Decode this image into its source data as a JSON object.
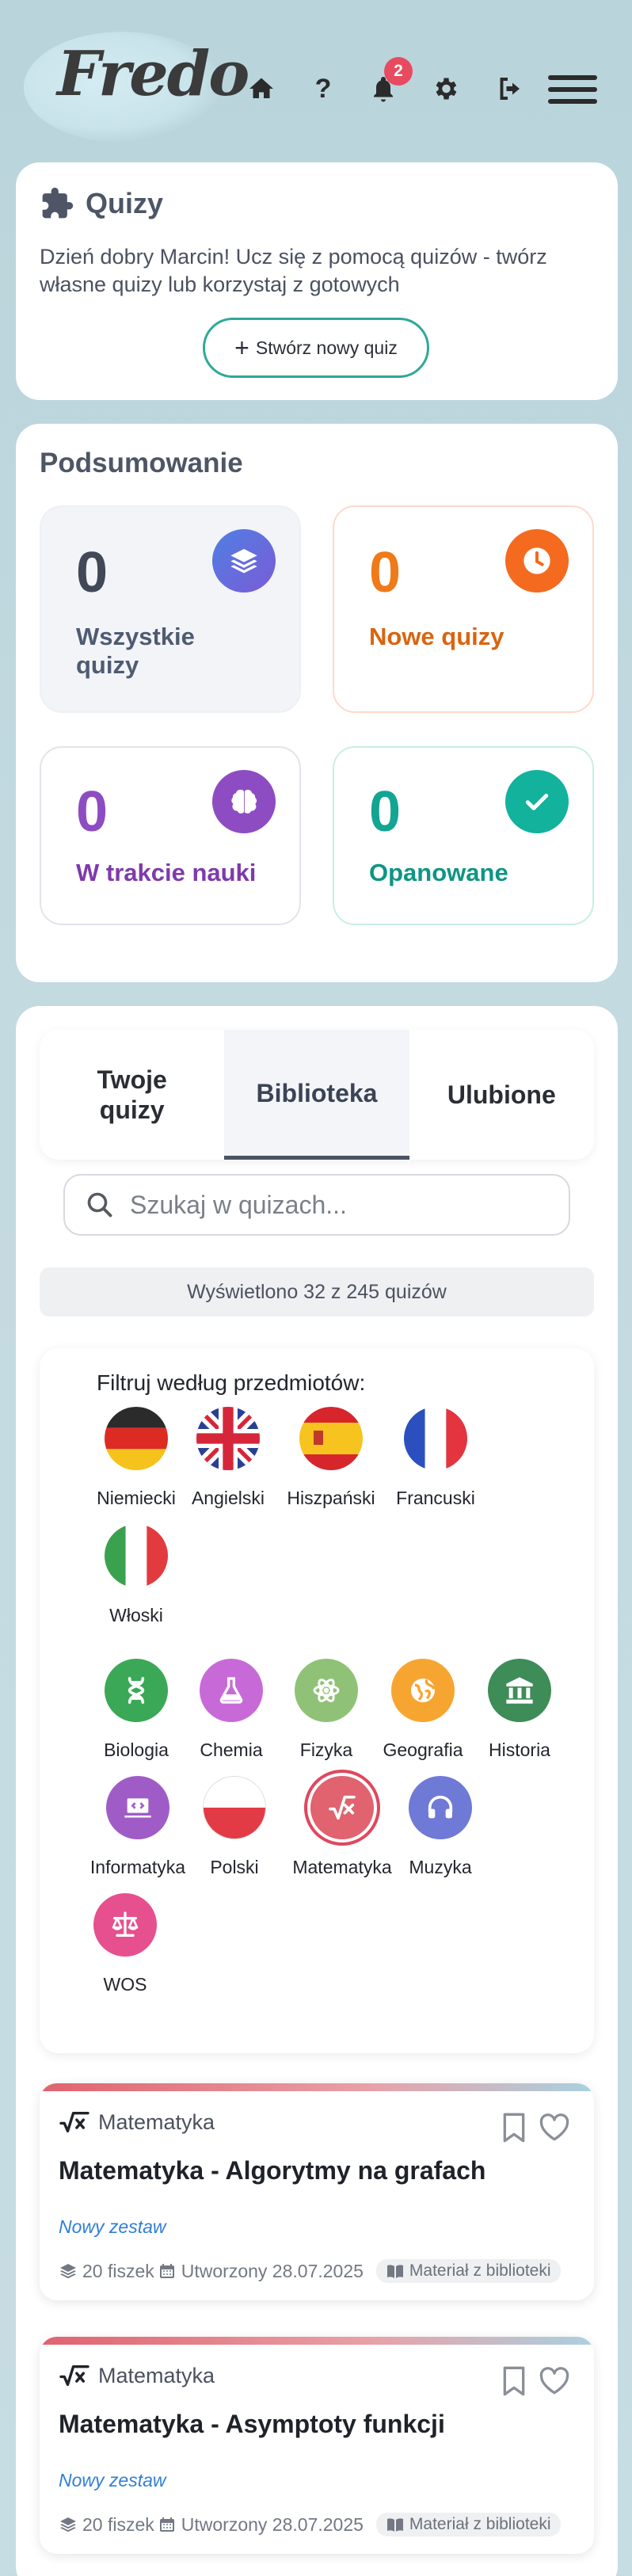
{
  "header": {
    "logo": "Fredo",
    "help_label": "?",
    "notifications_count": "2"
  },
  "quizzes": {
    "title": "Quizy",
    "description": "Dzień dobry Marcin! Ucz się z pomocą quizów - twórz własne quizy lub korzystaj z gotowych",
    "create_button": "Stwórz nowy quiz"
  },
  "summary": {
    "title": "Podsumowanie",
    "stats": [
      {
        "value": "0",
        "label": "Wszystkie quizy",
        "color": "#414857"
      },
      {
        "value": "0",
        "label": "Nowe quizy",
        "color": "#f07a18"
      },
      {
        "value": "0",
        "label": "W trakcie nauki",
        "color": "#8e4cc2"
      },
      {
        "value": "0",
        "label": "Opanowane",
        "color": "#12a593"
      }
    ]
  },
  "tabs": [
    {
      "label": "Twoje quizy",
      "active": false
    },
    {
      "label": "Biblioteka",
      "active": true
    },
    {
      "label": "Ulubione",
      "active": false
    }
  ],
  "search": {
    "placeholder": "Szukaj w quizach...",
    "value": ""
  },
  "results_count": "Wyświetlono 32 z 245 quizów",
  "filter": {
    "title": "Filtruj według przedmiotów:",
    "languages": [
      {
        "label": "Niemiecki",
        "icon": "flag-de"
      },
      {
        "label": "Angielski",
        "icon": "flag-gb"
      },
      {
        "label": "Hiszpański",
        "icon": "flag-es"
      },
      {
        "label": "Francuski",
        "icon": "flag-fr"
      },
      {
        "label": "Włoski",
        "icon": "flag-it"
      }
    ],
    "subjects": [
      {
        "label": "Biologia",
        "icon": "dna-icon",
        "color": "#3aa856"
      },
      {
        "label": "Chemia",
        "icon": "flask-icon",
        "color": "#c76ad8"
      },
      {
        "label": "Fizyka",
        "icon": "atom-icon",
        "color": "#8fc276"
      },
      {
        "label": "Geografia",
        "icon": "globe-icon",
        "color": "#f7a531"
      },
      {
        "label": "Historia",
        "icon": "landmark-icon",
        "color": "#3e8c58"
      },
      {
        "label": "Informatyka",
        "icon": "laptop-code-icon",
        "color": "#a05cc6"
      },
      {
        "label": "Polski",
        "icon": "flag-pl",
        "color": "#e23b46"
      },
      {
        "label": "Matematyka",
        "icon": "square-root-icon",
        "color": "#e0636f",
        "selected": true
      },
      {
        "label": "Muzyka",
        "icon": "headphones-icon",
        "color": "#6f79d6"
      },
      {
        "label": "WOS",
        "icon": "scale-icon",
        "color": "#e6508f"
      }
    ]
  },
  "quiz_cards": [
    {
      "subject": "Matematyka",
      "title": "Matematyka - Algorytmy na grafach",
      "status": "Nowy zestaw",
      "flashcards": "20 fiszek",
      "created": "Utworzony 28.07.2025",
      "source": "Materiał z biblioteki"
    },
    {
      "subject": "Matematyka",
      "title": "Matematyka - Asymptoty funkcji",
      "status": "Nowy zestaw",
      "flashcards": "20 fiszek",
      "created": "Utworzony 28.07.2025",
      "source": "Materiał z biblioteki"
    }
  ],
  "colors": {
    "accent_teal": "#2fa89a",
    "badge_red": "#e84a5f",
    "new_set_blue": "#2f7fd6"
  }
}
